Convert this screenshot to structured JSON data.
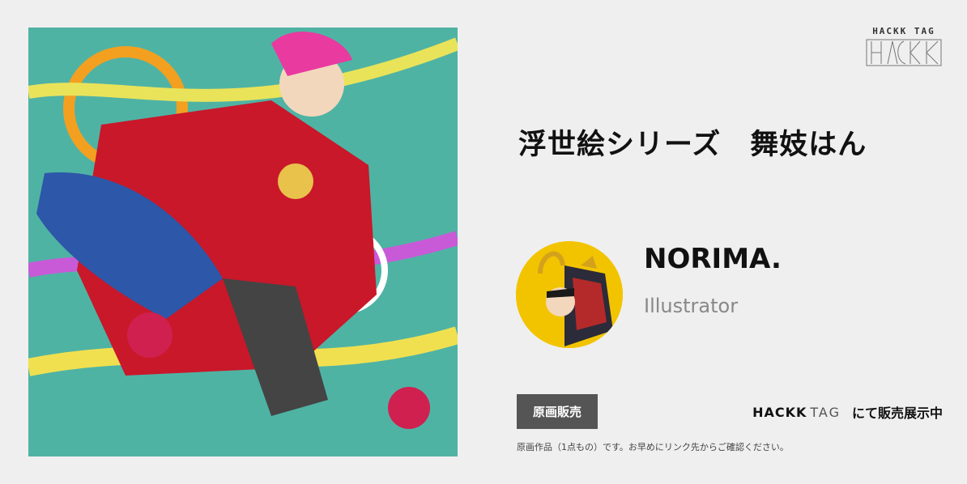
{
  "artwork": {
    "alt": "浮世絵シリーズ 舞妓はん"
  },
  "logo": {
    "text": "HACKK TAG"
  },
  "title": "浮世絵シリーズ　舞妓はん",
  "artist": {
    "name": "NORIMA.",
    "role": "Illustrator"
  },
  "badge": {
    "label": "原画販売"
  },
  "sale": {
    "brand_part1": "HACKK",
    "brand_part2": "TAG",
    "suffix": "にて販売展示中"
  },
  "note": "原画作品（1点もの）です。お早めにリンク先からご確認ください。",
  "colors": {
    "background": "#efefef",
    "badge": "#555555",
    "avatar_bg": "#f2c400",
    "art_bg": "#4fb3a4"
  }
}
